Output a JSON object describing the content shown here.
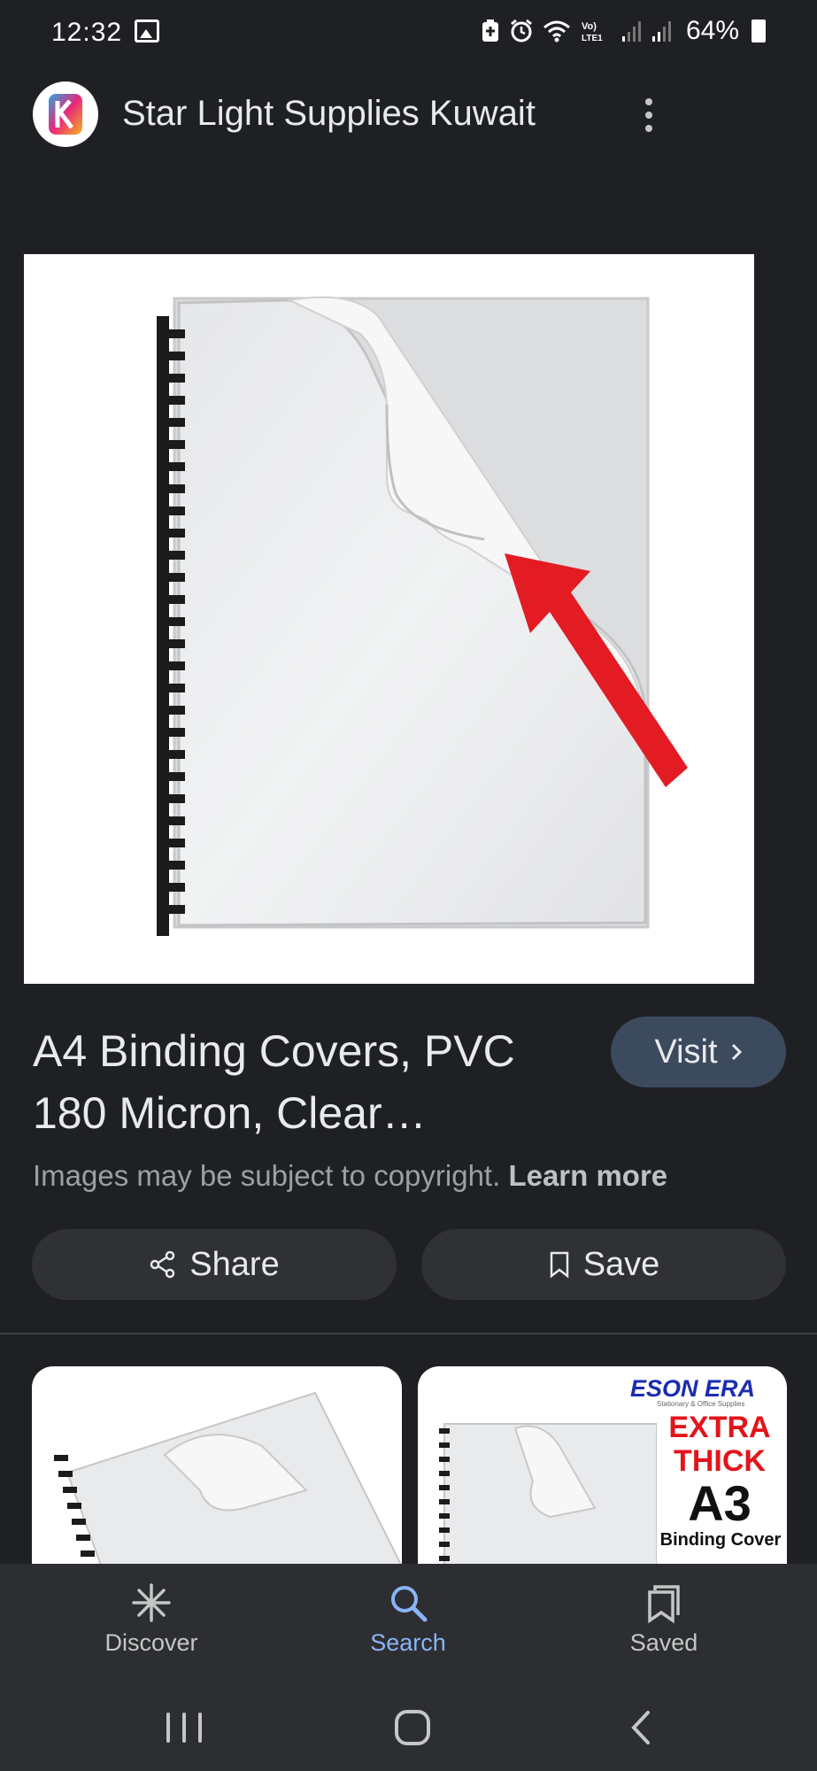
{
  "status_bar": {
    "time": "12:32",
    "battery": "64%",
    "lte_label": "Vo) LTE1"
  },
  "header": {
    "site_name": "Star Light Supplies Kuwait",
    "logo_text": "KL"
  },
  "result": {
    "title": "A4 Binding Covers, PVC 180 Micron, Clear…",
    "visit_label": "Visit",
    "copyright_text": "Images may be subject to copyright.",
    "learn_more_label": "Learn more",
    "share_label": "Share",
    "save_label": "Save"
  },
  "related": {
    "thumb2_brand": "ESON ERA",
    "thumb2_sub": "Stationary & Office Supplies",
    "thumb2_extra": "EXTRA THICK",
    "thumb2_size": "A3",
    "thumb2_product": "Binding Cover"
  },
  "bottom_nav": {
    "items": [
      {
        "label": "Discover",
        "icon": "discover-icon"
      },
      {
        "label": "Search",
        "icon": "search-icon",
        "active": true
      },
      {
        "label": "Saved",
        "icon": "saved-icon"
      }
    ]
  },
  "colors": {
    "background": "#1f2023",
    "accent": "#8ab4f8",
    "visit_button": "#3c4a5e",
    "arrow_red": "#e31b23"
  }
}
